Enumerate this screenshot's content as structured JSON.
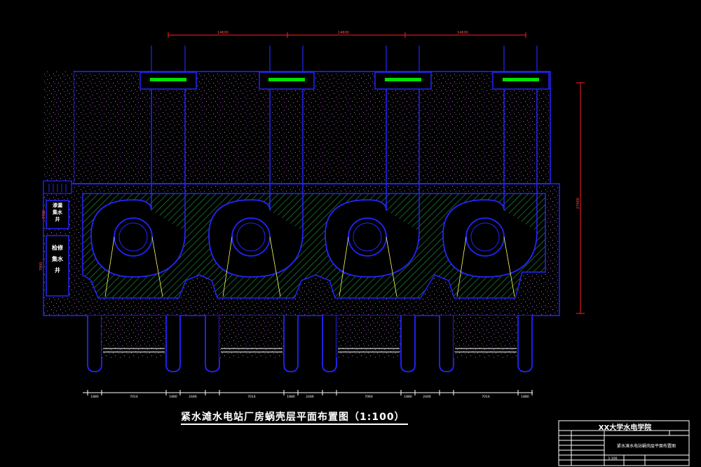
{
  "title": "紧水滩水电站厂房蜗壳层平面布置图（1:100）",
  "title_block": {
    "school": "XX大学水电学院",
    "drawing_name": "紧水滩水电站蜗壳层平面布置图",
    "scale": "1:100"
  },
  "wells": {
    "upper": "渗漏集水井",
    "lower": "检修集水井"
  },
  "dims": {
    "top": [
      "14600",
      "14600",
      "14600"
    ],
    "right": "27400",
    "left_upper": "3700",
    "left_lower": "7800",
    "bottom": [
      "1880",
      "7014",
      "1880",
      "2446",
      "7014",
      "1880",
      "2446",
      "7060",
      "1880",
      "2446",
      "7014",
      "1880"
    ]
  },
  "colors": {
    "outline": "#2424ff",
    "hatch": "#00ff00",
    "dim": "#ff2020",
    "speckle": "#b050d0"
  }
}
